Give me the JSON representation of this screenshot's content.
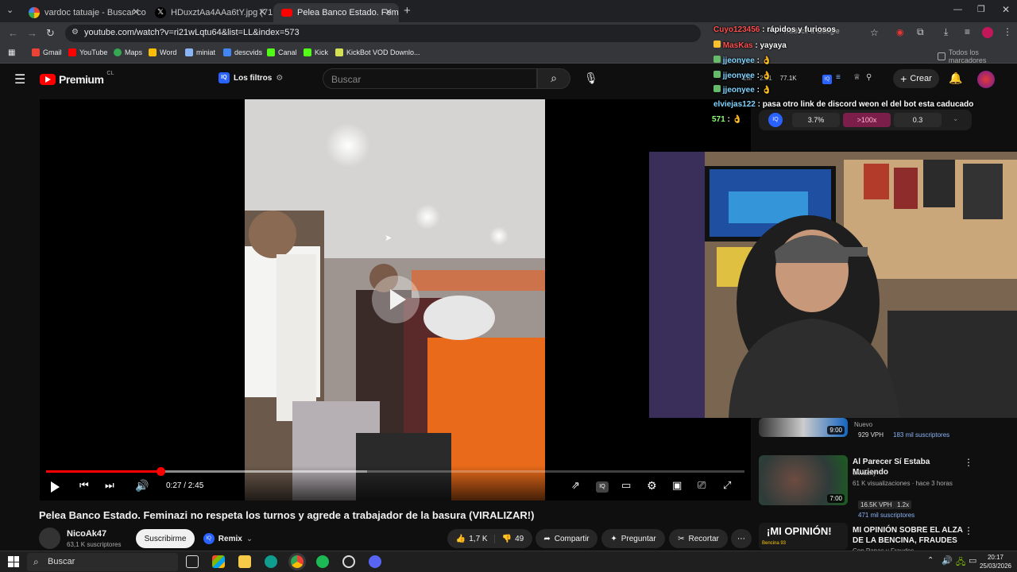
{
  "browser": {
    "tabs": [
      {
        "label": "vardoc tatuaje - Buscar con Go",
        "active": false
      },
      {
        "label": "HDuxztAa4AAa6tY.jpg (714×12",
        "active": false
      },
      {
        "label": "Pelea Banco Estado. Feminazi n",
        "active": true
      }
    ],
    "url": "youtube.com/watch?v=ri21wLqtu64&list=LL&index=573",
    "bookmarks": [
      "Gmail",
      "YouTube",
      "Maps",
      "Word",
      "miniat",
      "descvids",
      "Canal",
      "Kick",
      "KickBot VOD Downlo..."
    ],
    "bookmarks_folder": "Todos los marcadores",
    "translate_label": "Traducir a Google"
  },
  "youtube": {
    "logo_text": "Premium",
    "logo_sup": "CL",
    "filters_label": "Los filtros",
    "search_placeholder": "Buscar",
    "create_label": "Crear",
    "ext_stats": {
      "a": "2M",
      "b": "2.51",
      "c": "77.1K"
    },
    "ext_bar": {
      "pct": "3.7%",
      "mult": ">100x",
      "ratio": "0.3"
    }
  },
  "video": {
    "title": "Pelea Banco Estado. Feminazi no respeta los turnos y agrede a trabajador de la basura (VIRALIZAR!)",
    "time_current": "0:27",
    "time_total": "2:45",
    "time_display": "0:27 / 2:45",
    "progress_fraction": 0.164,
    "buffer_fraction": 0.46,
    "channel": "NicoAk47",
    "subscribers": "63,1 K suscriptores",
    "subscribe_label": "Suscribirme",
    "remix_label": "Remix",
    "likes": "1,7 K",
    "dislikes": "49",
    "share_label": "Compartir",
    "ask_label": "Preguntar",
    "clip_label": "Recortar"
  },
  "chat": [
    {
      "user": "Cuyo123456",
      "msg": "rápidos y furiosos",
      "color": "#ff4f4f"
    },
    {
      "user": "MasKas",
      "msg": "yayaya",
      "color": "#ff4f4f"
    },
    {
      "user": "jjeonyee",
      "msg": "",
      "color": "#7fd4ff"
    },
    {
      "user": "jjeonyee",
      "msg": "",
      "color": "#7fd4ff"
    },
    {
      "user": "jjeonyee",
      "msg": "",
      "color": "#7fd4ff"
    },
    {
      "user": "elviejas122",
      "msg": "pasa otro link de discord weon el del bot esta caducado",
      "color": "#7fd4ff"
    },
    {
      "user": "571",
      "msg": "",
      "color": "#8cff6e"
    }
  ],
  "sidebar": {
    "items": [
      {
        "badge_new": "Nuevo",
        "vph": "929 VPH",
        "subs": "183 mil suscriptores",
        "duration": "9:00"
      },
      {
        "title": "Al Parecer Sí Estaba Muriendo",
        "channel": "elWacky",
        "meta": "61 K visualizaciones · hace 3 horas",
        "vph": "16.5K VPH",
        "mult": "1.2x",
        "subs": "471 mil suscriptores",
        "duration": "7:00"
      },
      {
        "title": "MI OPINIÓN SOBRE EL ALZA DE LA BENCINA, FRAUDES ...",
        "channel": "Con Papas y Fraudes",
        "thumb_text": "¡MI OPINIÓN!",
        "thumb_sub": "Bencina 93"
      }
    ]
  },
  "taskbar": {
    "search_placeholder": "Buscar",
    "time": "20:17",
    "date": "25/03/2026"
  },
  "colors": {
    "accent": "#ff0000",
    "background": "#0f0f0f",
    "chip": "#272727"
  }
}
